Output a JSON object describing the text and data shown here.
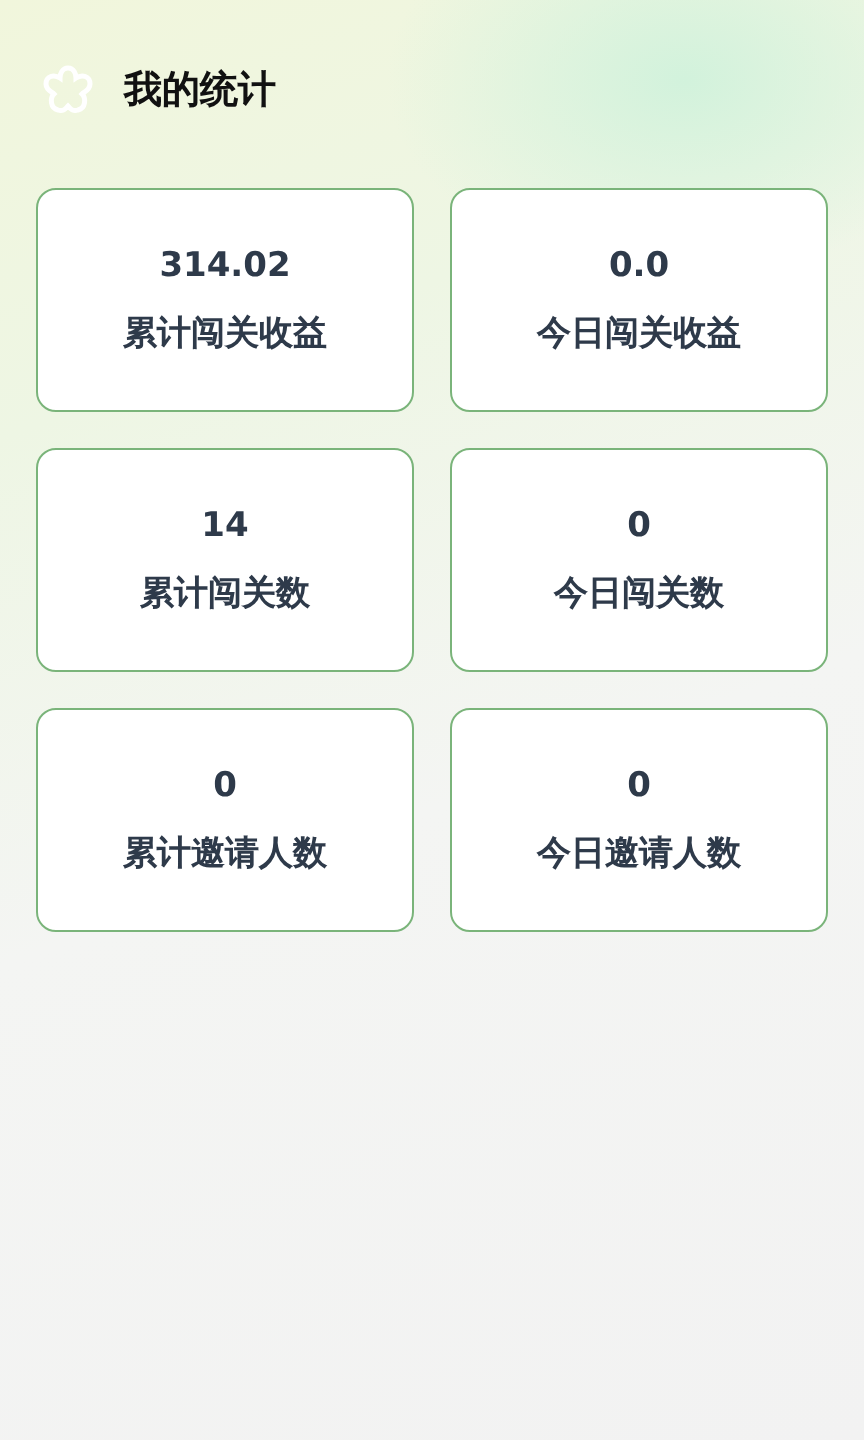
{
  "header": {
    "title": "我的统计"
  },
  "stats": [
    {
      "value": "314.02",
      "label": "累计闯关收益"
    },
    {
      "value": "0.0",
      "label": "今日闯关收益"
    },
    {
      "value": "14",
      "label": "累计闯关数"
    },
    {
      "value": "0",
      "label": "今日闯关数"
    },
    {
      "value": "0",
      "label": "累计邀请人数"
    },
    {
      "value": "0",
      "label": "今日邀请人数"
    }
  ]
}
